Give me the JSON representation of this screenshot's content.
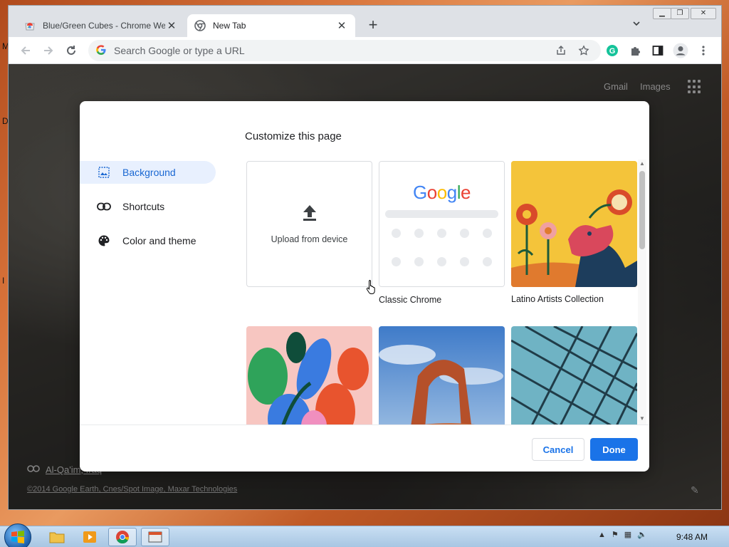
{
  "desktop": {
    "edge_letters": [
      "M",
      "D",
      "I"
    ]
  },
  "browser": {
    "tabs": [
      {
        "title": "Blue/Green Cubes - Chrome Web Store",
        "active": false
      },
      {
        "title": "New Tab",
        "active": true
      }
    ],
    "omnibox": {
      "placeholder": "Search Google or type a URL",
      "value": ""
    }
  },
  "ntp": {
    "links": [
      "Gmail",
      "Images"
    ],
    "attribution": {
      "location": "Al-Qa'im, Iraq",
      "credit": "©2014 Google Earth, Cnes/Spot Image, Maxar Technologies"
    }
  },
  "dialog": {
    "title": "Customize this page",
    "nav": [
      {
        "label": "Background",
        "icon": "image-icon",
        "selected": true
      },
      {
        "label": "Shortcuts",
        "icon": "link-icon",
        "selected": false
      },
      {
        "label": "Color and theme",
        "icon": "palette-icon",
        "selected": false
      }
    ],
    "tiles": {
      "upload": "Upload from device",
      "classic": "Classic Chrome",
      "classic_logo": "Google",
      "latino": "Latino Artists Collection"
    },
    "buttons": {
      "cancel": "Cancel",
      "done": "Done"
    }
  },
  "colors": {
    "accent": "#1a73e8",
    "nav_selected_bg": "#e8f0fe",
    "google_blue": "#4285f4",
    "google_red": "#ea4335",
    "google_yellow": "#fbbc05",
    "google_green": "#34a853"
  },
  "taskbar": {
    "clock": "9:48 AM"
  }
}
